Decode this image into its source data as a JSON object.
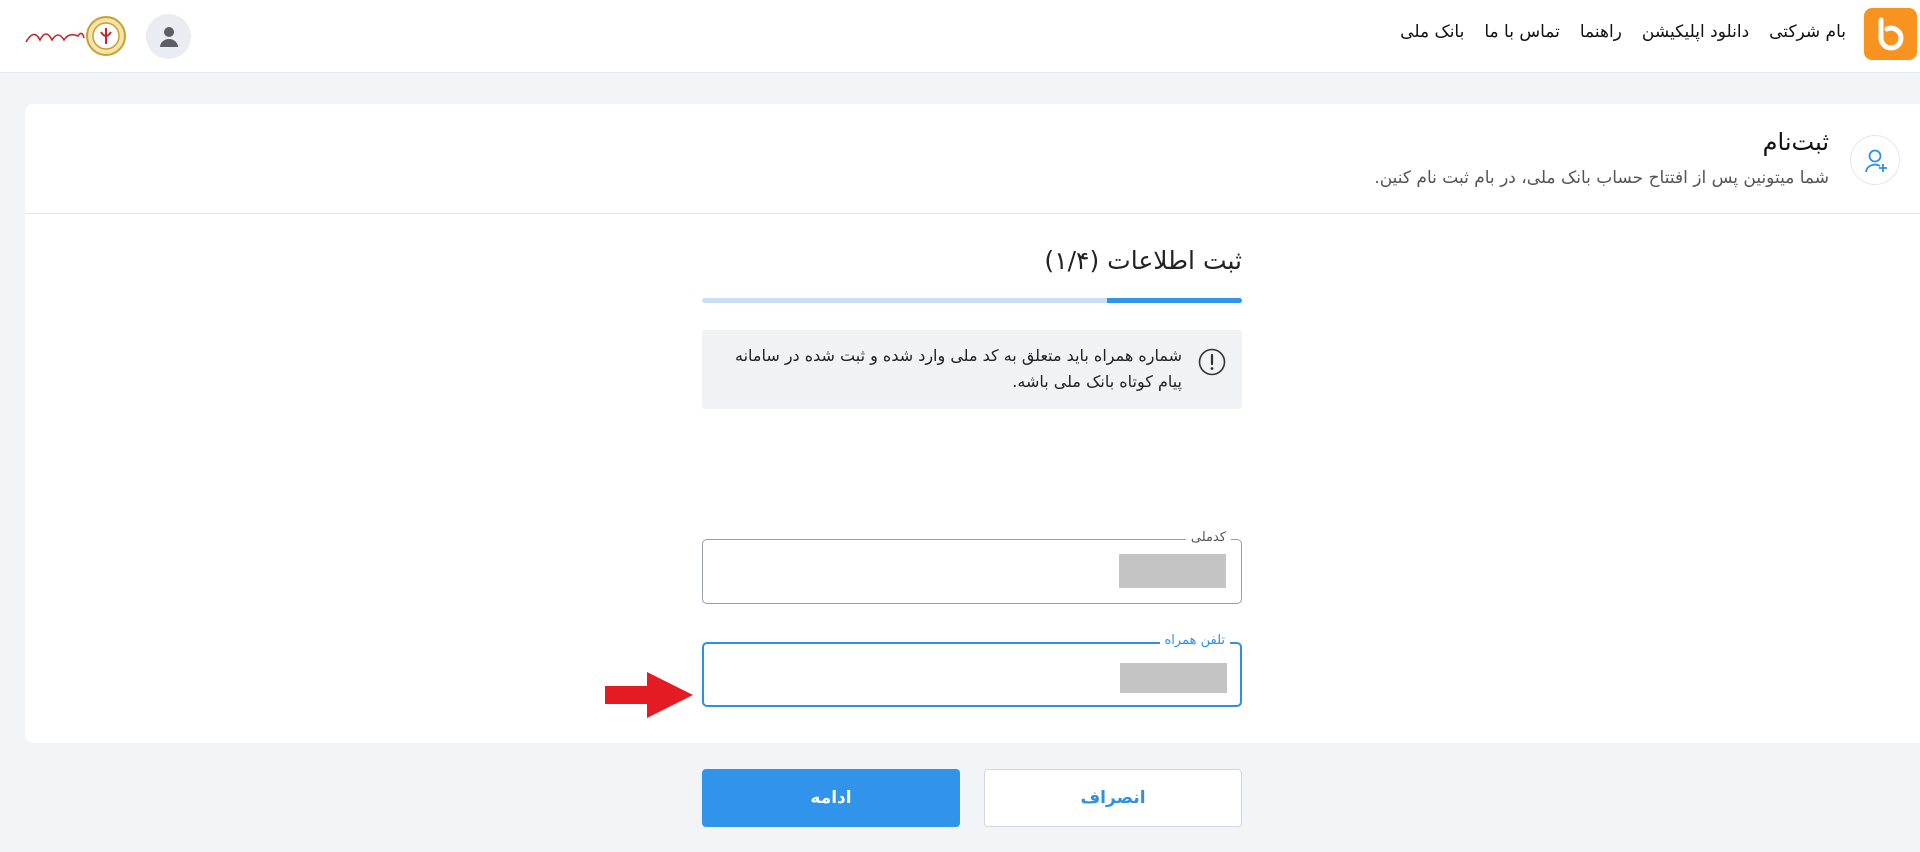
{
  "nav": {
    "items": [
      "بانک ملی",
      "تماس با ما",
      "راهنما",
      "دانلود اپلیکیشن",
      "بام شرکتی"
    ],
    "brand_color": "#f7931e"
  },
  "bank_logo_text": "بانک ملی ایران",
  "header": {
    "title": "ثبت‌نام",
    "subtitle": "شما میتونین پس از افتتاح حساب بانک ملی، در بام ثبت نام کنین."
  },
  "form": {
    "step_title": "ثبت اطلاعات (۱/۴)",
    "progress": 0.25,
    "notice": "شماره همراه باید متعلق به کد ملی وارد شده و ثبت شده در سامانه پیام کوتاه بانک ملی باشه.",
    "national_id_label": "کدملی",
    "phone_label": "تلفن همراه",
    "continue_label": "ادامه",
    "cancel_label": "انصراف"
  },
  "colors": {
    "accent": "#3094ea",
    "progress_track": "#c7e0f5",
    "annotation_arrow": "#e51b24"
  }
}
